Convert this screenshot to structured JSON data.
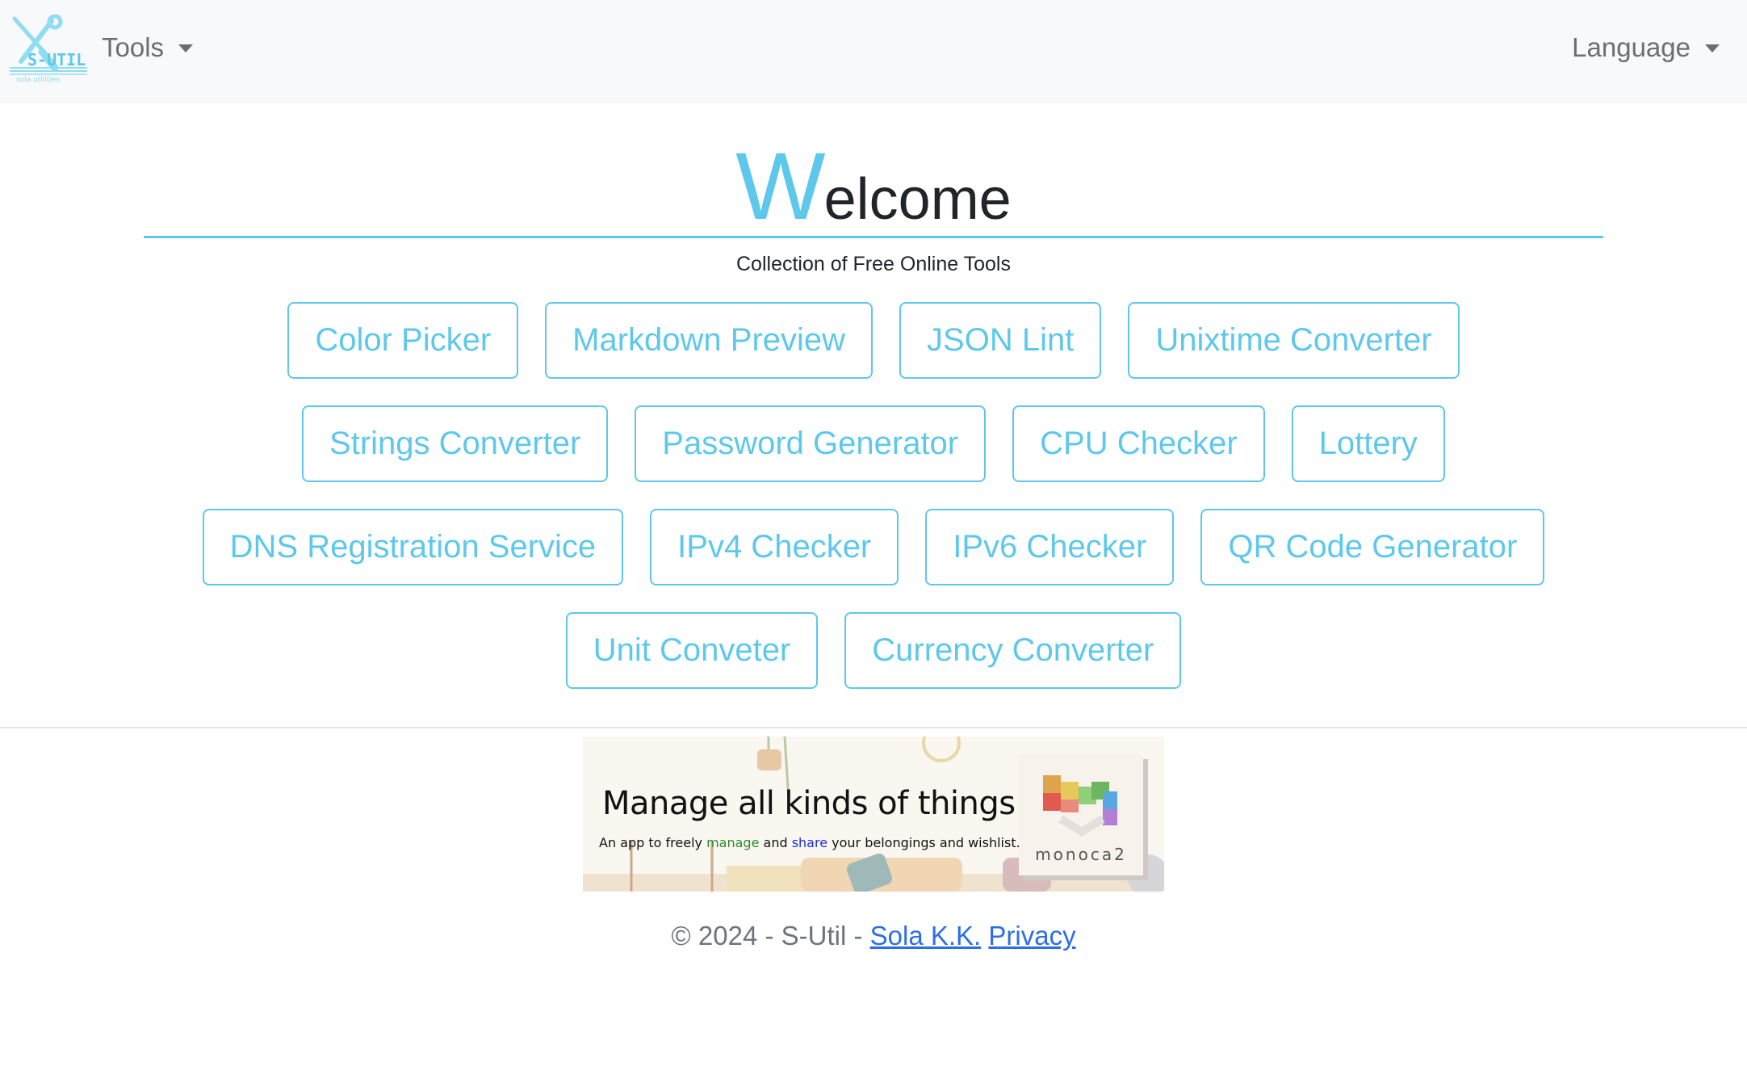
{
  "navbar": {
    "logo": {
      "main_text": "S-UTIL",
      "sub_text": "sola utilities",
      "icon": "wrench-screwdriver-icon"
    },
    "tools_label": "Tools",
    "language_label": "Language"
  },
  "hero": {
    "title_first_letter": "W",
    "title_rest": "elcome",
    "subtitle": "Collection of Free Online Tools",
    "accent_color": "#5ec8ec"
  },
  "tools": {
    "rows": [
      [
        "Color Picker",
        "Markdown Preview",
        "JSON Lint",
        "Unixtime Converter"
      ],
      [
        "Strings Converter",
        "Password Generator",
        "CPU Checker",
        "Lottery"
      ],
      [
        "DNS Registration Service",
        "IPv4 Checker",
        "IPv6 Checker",
        "QR Code Generator"
      ],
      [
        "Unit Conveter",
        "Currency Converter"
      ]
    ]
  },
  "ad": {
    "headline": "Manage all kinds of things",
    "sub_prefix": "An app to freely ",
    "sub_manage": "manage",
    "sub_and": " and ",
    "sub_share": "share",
    "sub_suffix": " your belongings and wishlist.",
    "brand": "monoca2"
  },
  "footer": {
    "copyright": "© 2024 - S-Util - ",
    "company_link": "Sola K.K.",
    "privacy_link": "Privacy",
    "link_color": "#2c6ee8"
  }
}
